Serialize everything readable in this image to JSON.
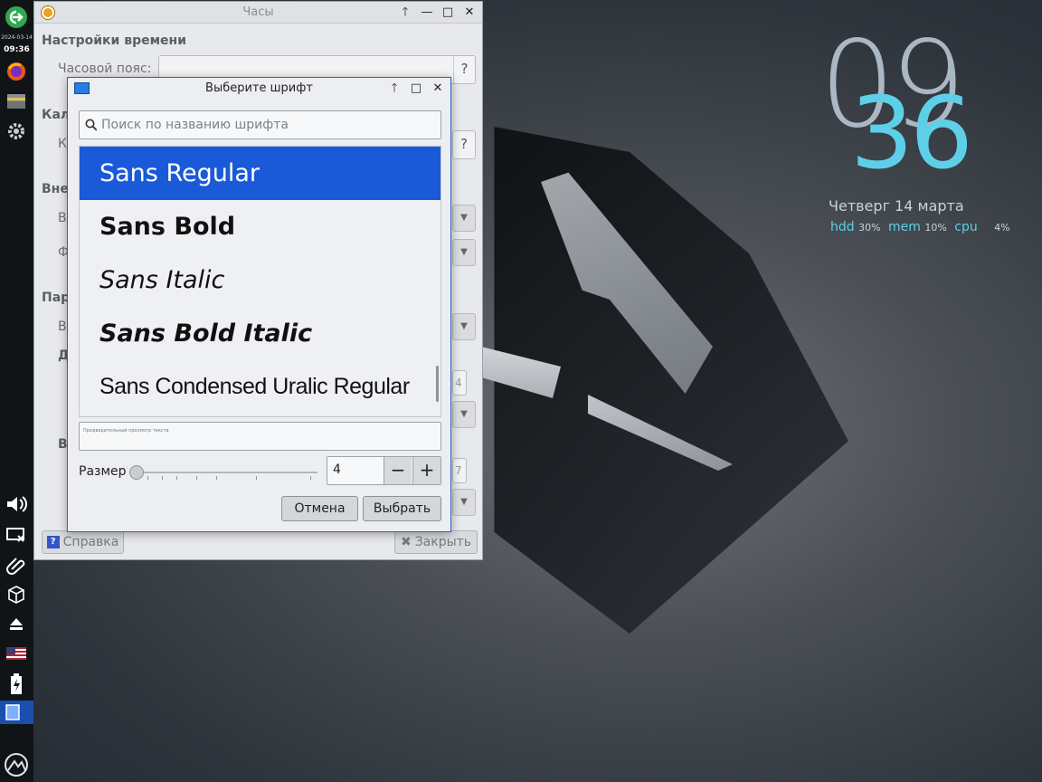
{
  "panel": {
    "date": "2024-03-14",
    "time": "09:36",
    "items": [
      "logout-icon",
      "firefox-icon",
      "file-manager-icon",
      "settings-icon",
      "volume-icon",
      "network-icon",
      "clipboard-icon",
      "package-icon",
      "eject-icon",
      "keyboard-layout-flag-icon",
      "battery-icon",
      "window-task-icon",
      "menu-logo-icon"
    ]
  },
  "conky": {
    "hour": "09",
    "minute": "36",
    "date": "Четверг  14 марта",
    "stats": [
      {
        "label": "hdd",
        "value": "30%"
      },
      {
        "label": "mem",
        "value": "10%"
      },
      {
        "label": "cpu",
        "value": "4%"
      }
    ]
  },
  "clock_window": {
    "title": "Часы",
    "section_time": "Настройки времени",
    "timezone_label": "Часовой пояс:",
    "timezone_value": "",
    "help_glyph": "?",
    "partial_labels": [
      "Кал",
      "К",
      "Вне",
      "В",
      "Ф",
      "Пар",
      "В",
      "Д",
      "В"
    ],
    "spin_partial": "4",
    "spin_partial2": "7",
    "help_button": "Справка",
    "close_button": "Закрыть"
  },
  "font_dialog": {
    "title": "Выберите шрифт",
    "search_placeholder": "Поиск по названию шрифта",
    "fonts": [
      {
        "name": "Sans Regular",
        "selected": true
      },
      {
        "name": "Sans Bold",
        "selected": false
      },
      {
        "name": "Sans Italic",
        "selected": false
      },
      {
        "name": "Sans Bold Italic",
        "selected": false
      },
      {
        "name": "Sans Condensed Uralic Regular",
        "selected": false
      }
    ],
    "preview_text": "Предварительный просмотр текста",
    "size_label": "Размер",
    "size_value": "4",
    "minus": "−",
    "plus": "+",
    "cancel": "Отмена",
    "select": "Выбрать"
  },
  "colors": {
    "selection": "#1a5ad9",
    "conky_accent": "#5ecfe8",
    "active_task": "#1a4fae"
  }
}
